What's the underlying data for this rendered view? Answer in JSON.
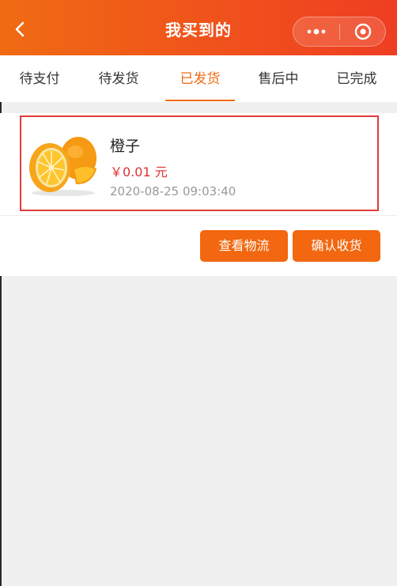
{
  "header": {
    "title": "我买到的",
    "colors": {
      "gradient_start": "#f06b13",
      "gradient_end": "#ee3e22"
    }
  },
  "tabs": [
    {
      "label": "待支付"
    },
    {
      "label": "待发货"
    },
    {
      "label": "已发货",
      "active": true
    },
    {
      "label": "售后中"
    },
    {
      "label": "已完成"
    }
  ],
  "order": {
    "product_name": "橙子",
    "price": "￥0.01 元",
    "datetime": "2020-08-25 09:03:40",
    "image": "orange-halves-image"
  },
  "actions": {
    "view_logistics": "查看物流",
    "confirm_receipt": "确认收货"
  },
  "accent_color": "#f26b12"
}
